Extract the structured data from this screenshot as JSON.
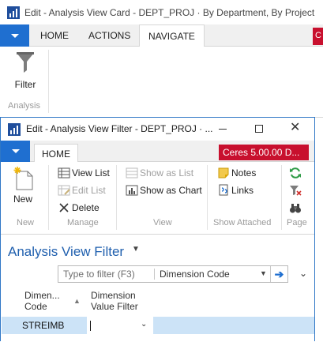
{
  "background_window": {
    "title": "Edit - Analysis View Card - DEPT_PROJ · By Department, By Project",
    "tabs": {
      "home": "HOME",
      "actions": "ACTIONS",
      "navigate": "NAVIGATE"
    },
    "badge": "C",
    "ribbon": {
      "filter_label": "Filter",
      "group_label": "Analysis"
    }
  },
  "dialog": {
    "title": "Edit - Analysis View Filter - DEPT_PROJ · ...",
    "controls": {
      "close": "✕"
    },
    "tabs": {
      "home": "HOME"
    },
    "badge": "Ceres 5.00.00 D...",
    "ribbon": {
      "new": {
        "label": "New",
        "group": "New"
      },
      "manage": {
        "view_list": "View List",
        "edit_list": "Edit List",
        "delete": "Delete",
        "group": "Manage"
      },
      "view": {
        "show_as_list": "Show as List",
        "show_as_chart": "Show as Chart",
        "group": "View"
      },
      "show_attached": {
        "notes": "Notes",
        "links": "Links",
        "group": "Show Attached"
      },
      "page": {
        "group": "Page"
      }
    },
    "page_title": "Analysis View Filter",
    "filter_bar": {
      "placeholder": "Type to filter (F3)",
      "field": "Dimension Code"
    },
    "columns": {
      "dimension_code": "Dimen...\nCode",
      "dimension_value_filter": "Dimension\nValue Filter"
    },
    "rows": [
      {
        "dimension_code": "STREIMB",
        "dimension_value_filter": ""
      }
    ]
  },
  "colors": {
    "accent_blue": "#1f6fd0",
    "badge_red": "#c8102e",
    "title_blue": "#1f5fae",
    "row_selected": "#cce3f7"
  }
}
